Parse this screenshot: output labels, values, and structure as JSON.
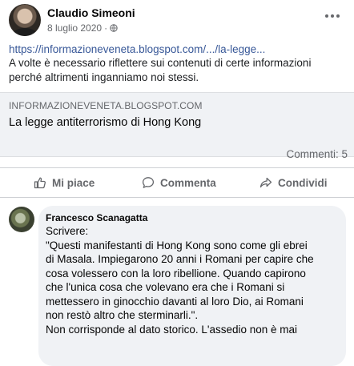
{
  "post": {
    "author": "Claudio Simeoni",
    "date": "8 luglio 2020",
    "privacy_icon": "globe-icon",
    "link_text": "https://informazioneveneta.blogspot.com/.../la-legge...",
    "text": "A volte è necessario riflettere sui contenuti di certe informazioni perché altrimenti inganniamo noi stessi."
  },
  "preview": {
    "domain": "INFORMAZIONEVENETA.BLOGSPOT.COM",
    "title": "La legge antiterrorismo di Hong Kong"
  },
  "stats": {
    "comments": "Commenti: 5"
  },
  "actions": {
    "like": "Mi piace",
    "comment": "Commenta",
    "share": "Condividi"
  },
  "comment": {
    "author": "Francesco Scanagatta",
    "lines": [
      "Scrivere:",
      "\"Questi manifestanti di Hong Kong sono come gli ebrei",
      "di Masala. Impiegarono 20 anni i Romani per capire che",
      "cosa volessero con la loro ribellione. Quando capirono",
      "che l'unica cosa che volevano era che i Romani si",
      "mettessero in ginocchio davanti al loro Dio, ai Romani",
      "non restò altro che sterminarli.\".",
      "Non corrisponde al dato storico. L'assedio non è mai"
    ]
  },
  "colors": {
    "link": "#385898",
    "secondary_text": "#65676b",
    "preview_bg": "#f0f2f5"
  }
}
